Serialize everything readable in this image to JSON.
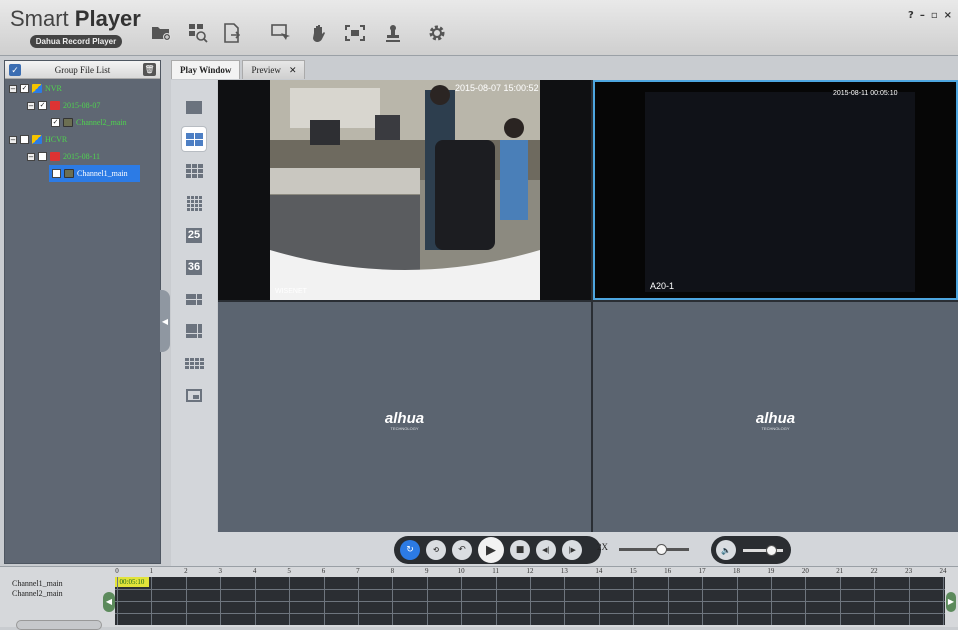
{
  "app": {
    "name_light": "Smart ",
    "name_bold": "Player",
    "subtitle": "Dahua Record Player",
    "window_controls": [
      "?",
      "–",
      "▫",
      "×"
    ]
  },
  "toolbar": {
    "icons": [
      "open-folder-icon",
      "search-files-icon",
      "export-file-icon",
      "clip-icon",
      "pan-hand-icon",
      "fullscreen-icon",
      "stamp-icon",
      "settings-gear-icon"
    ]
  },
  "left_panel": {
    "title": "Group File List",
    "tree": [
      {
        "label": "NVR",
        "level": 0
      },
      {
        "label": "2015-08-07",
        "level": 1
      },
      {
        "label": "Channel2_main",
        "level": 2
      },
      {
        "label": "HCVR",
        "level": 0
      },
      {
        "label": "2015-08-11",
        "level": 1
      },
      {
        "label": "Channel1_main",
        "level": 2,
        "selected": true
      }
    ]
  },
  "tabs": [
    {
      "label": "Play Window",
      "active": true
    },
    {
      "label": "Preview",
      "closable": true
    }
  ],
  "split_layouts": [
    "1",
    "4",
    "9",
    "16",
    "25",
    "36",
    "6",
    "8",
    "13",
    "custom"
  ],
  "split_numbers": {
    "s25": "25",
    "s36": "36"
  },
  "video": {
    "cell1_timestamp": "2015-08-07 15:00:52",
    "cell1_bottom_label": "WISENET",
    "cell2_timestamp": "2015-08-11 00:05:10",
    "cell2_camera": "A20-1",
    "brand": "alhua",
    "brand_sub": "TECHNOLOGY"
  },
  "controls": {
    "speed_label": "2X",
    "speed_level": 0.6,
    "volume_level": 0.7
  },
  "timeline": {
    "channels": [
      "Channel1_main",
      "Channel2_main"
    ],
    "hours": [
      "0",
      "1",
      "2",
      "3",
      "4",
      "5",
      "6",
      "7",
      "8",
      "9",
      "10",
      "11",
      "12",
      "13",
      "14",
      "15",
      "16",
      "17",
      "18",
      "19",
      "20",
      "21",
      "22",
      "23",
      "24"
    ],
    "current_time": "00:05:10"
  },
  "colors": {
    "accent": "#2c7be5",
    "tree_text": "#4fd34f",
    "empty_cell": "#5b6470",
    "timeline_marker": "#e2e33a"
  }
}
